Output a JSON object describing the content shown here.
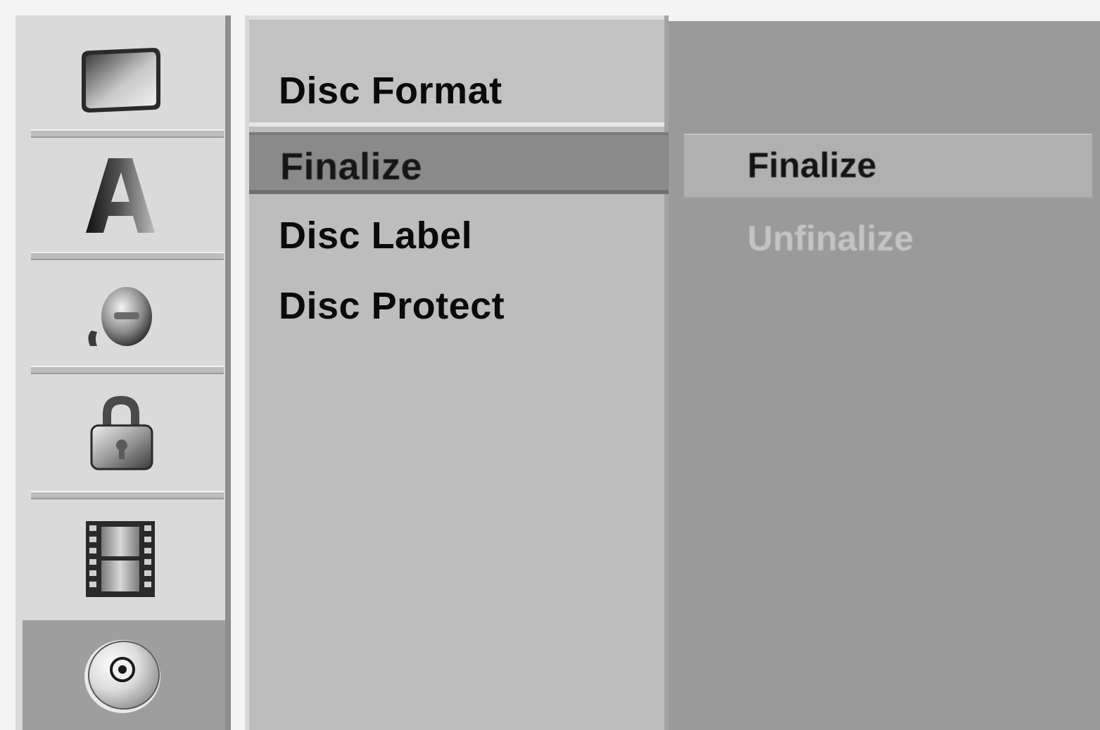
{
  "sidebar": {
    "items": [
      {
        "icon": "tv-icon",
        "label": ""
      },
      {
        "icon": "letter-a-icon",
        "label": ""
      },
      {
        "icon": "speaker-icon",
        "label": ""
      },
      {
        "icon": "lock-icon",
        "label": ""
      },
      {
        "icon": "film-icon",
        "label": ""
      },
      {
        "icon": "disc-icon",
        "label": "",
        "selected": true
      }
    ]
  },
  "menu": {
    "items": [
      {
        "label": "Disc Format"
      },
      {
        "label": "Finalize",
        "selected": true
      },
      {
        "label": "Disc Label"
      },
      {
        "label": "Disc Protect"
      }
    ]
  },
  "options": {
    "items": [
      {
        "label": "Finalize",
        "selected": true
      },
      {
        "label": "Unfinalize",
        "disabled": true
      }
    ]
  },
  "colors": {
    "sidebar_bg": "#dadada",
    "menu_bg": "#bdbdbd",
    "highlight": "#8a8a8a",
    "option_bg": "#9a9a9a",
    "text": "#0a0a0a"
  }
}
